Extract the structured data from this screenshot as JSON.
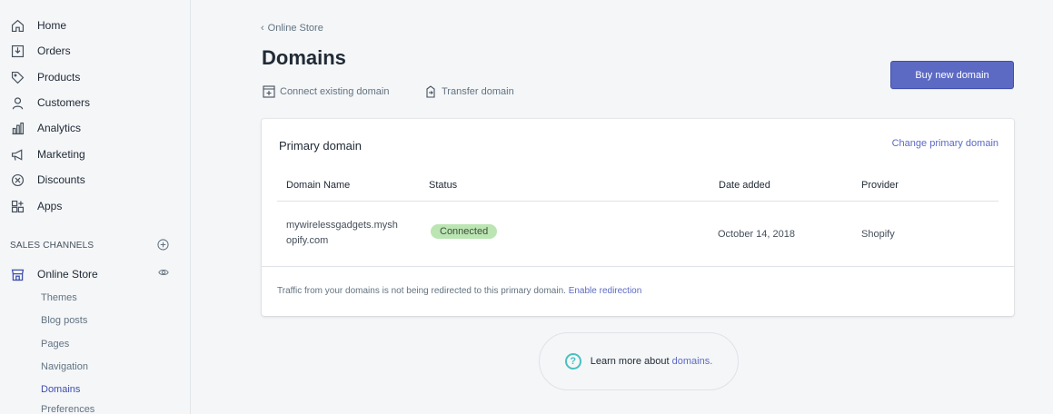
{
  "sidebar": {
    "items": [
      {
        "label": "Home",
        "icon": "home-icon"
      },
      {
        "label": "Orders",
        "icon": "orders-icon"
      },
      {
        "label": "Products",
        "icon": "tag-icon"
      },
      {
        "label": "Customers",
        "icon": "person-icon"
      },
      {
        "label": "Analytics",
        "icon": "bar-chart-icon"
      },
      {
        "label": "Marketing",
        "icon": "megaphone-icon"
      },
      {
        "label": "Discounts",
        "icon": "discount-icon"
      },
      {
        "label": "Apps",
        "icon": "apps-icon"
      }
    ],
    "sales_channels_title": "SALES CHANNELS",
    "online_store": "Online Store",
    "sub_items": [
      "Themes",
      "Blog posts",
      "Pages",
      "Navigation",
      "Domains",
      "Preferences"
    ]
  },
  "main": {
    "back_label": "Online Store",
    "title": "Domains",
    "connect_label": "Connect existing domain",
    "transfer_label": "Transfer domain",
    "buy_button": "Buy new domain",
    "card": {
      "title": "Primary domain",
      "change_link": "Change primary domain",
      "headers": {
        "domain": "Domain Name",
        "status": "Status",
        "date": "Date added",
        "provider": "Provider"
      },
      "row": {
        "domain_line1": "mywirelessgadgets.mysh",
        "domain_line2": "opify.com",
        "status": "Connected",
        "date": "October 14, 2018",
        "provider": "Shopify"
      },
      "traffic_text": "Traffic from your domains is not being redirected to this primary domain.",
      "enable_link": "Enable redirection"
    },
    "learn_more": {
      "prefix": "Learn more about",
      "link": "domains."
    }
  },
  "colors": {
    "accent": "#5c6ac4",
    "badge_bg": "#bbe5b3",
    "help_icon": "#47c1bf"
  }
}
